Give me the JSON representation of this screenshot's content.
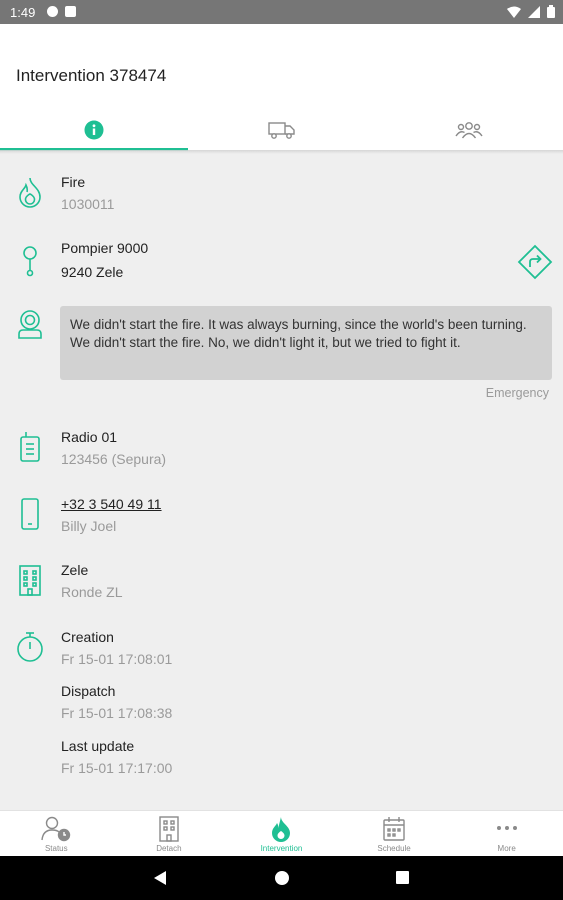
{
  "statusbar": {
    "time": "1:49"
  },
  "header": {
    "title": "Intervention 378474"
  },
  "tabs": [
    {
      "name": "info-icon",
      "active": true
    },
    {
      "name": "truck-icon",
      "active": false
    },
    {
      "name": "people-icon",
      "active": false
    }
  ],
  "incident": {
    "type": "Fire",
    "code": "1030011"
  },
  "location": {
    "line1": "Pompier 9000",
    "line2": "9240 Zele"
  },
  "message": {
    "text": "We didn't start the fire. It was always burning, since the world's been turning. We didn't start the fire. No, we didn't light it, but we tried to fight it.",
    "label": "Emergency"
  },
  "radio": {
    "name": "Radio 01",
    "detail": "123456 (Sepura)"
  },
  "contact": {
    "phone": "+32 3 540 49 11",
    "name": "Billy Joel"
  },
  "building": {
    "name": "Zele",
    "detail": "Ronde ZL"
  },
  "times": {
    "creation_label": "Creation",
    "creation_value": "Fr 15-01 17:08:01",
    "dispatch_label": "Dispatch",
    "dispatch_value": "Fr 15-01 17:08:38",
    "update_label": "Last update",
    "update_value": "Fr 15-01 17:17:00"
  },
  "bottomnav": [
    {
      "label": "Status",
      "icon": "person-clock-icon"
    },
    {
      "label": "Detach",
      "icon": "building-icon"
    },
    {
      "label": "Intervention",
      "icon": "flame-icon",
      "active": true
    },
    {
      "label": "Schedule",
      "icon": "calendar-icon"
    },
    {
      "label": "More",
      "icon": "more-dots-icon"
    }
  ],
  "colors": {
    "accent": "#1fbf93",
    "statusbar": "#767676",
    "background": "#efefef"
  }
}
